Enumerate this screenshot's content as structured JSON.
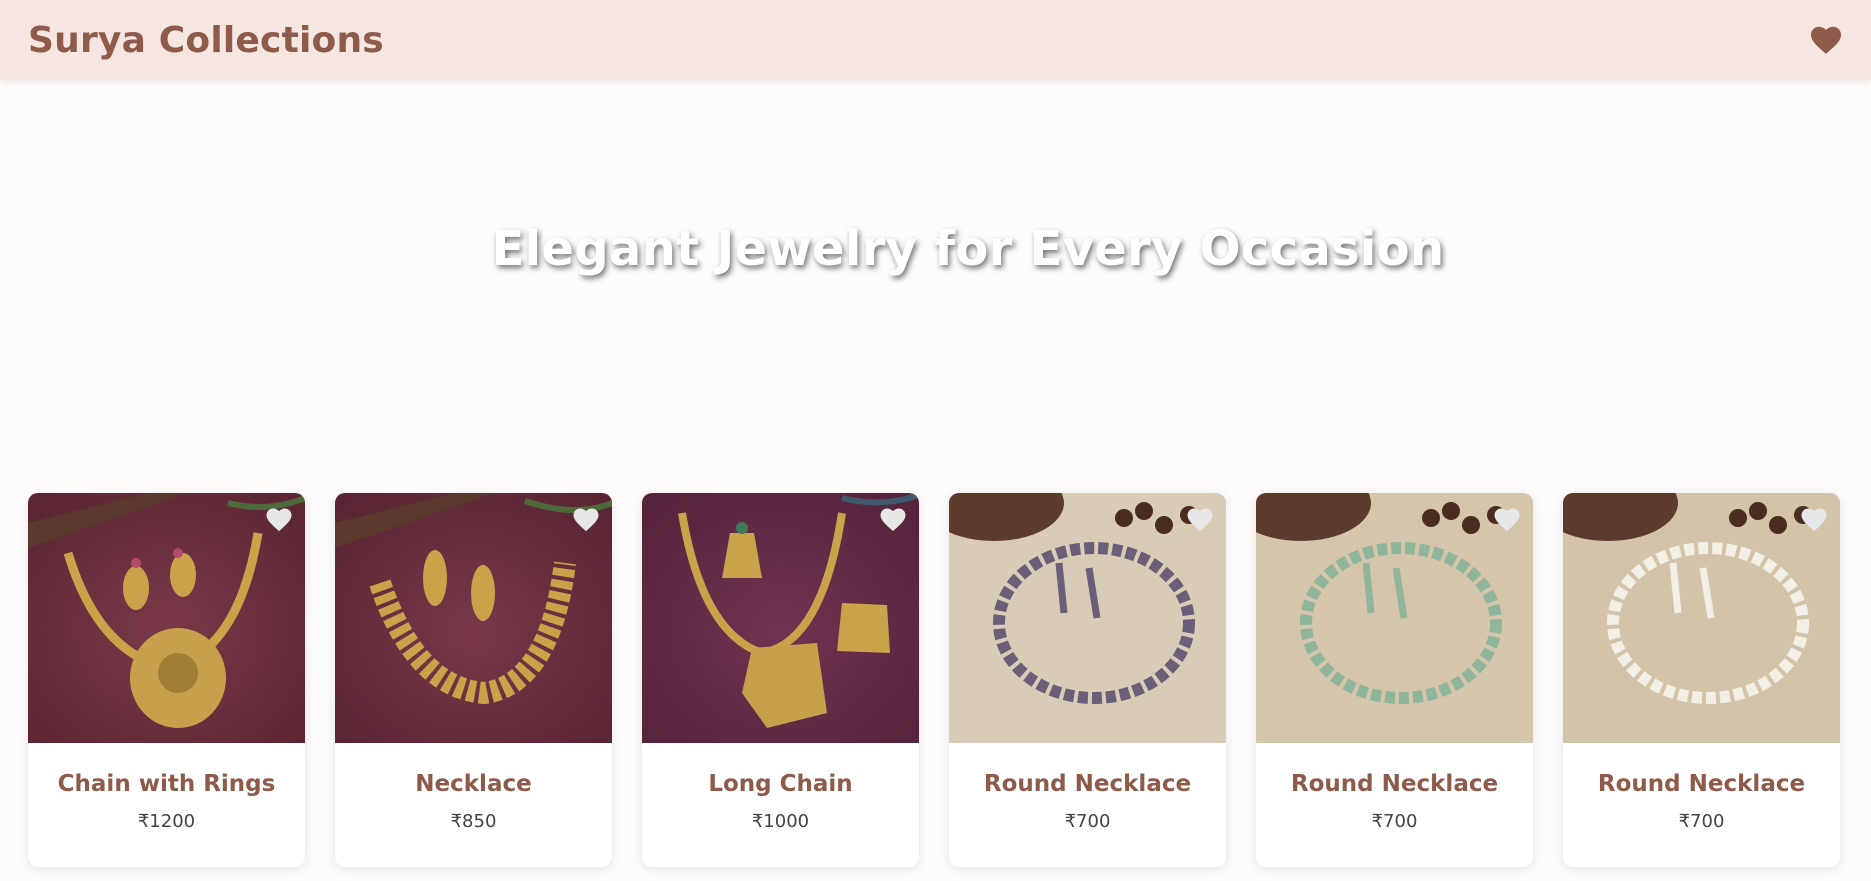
{
  "header": {
    "brand": "Surya Collections",
    "wishlist_icon": "heart-icon",
    "brand_color": "#8e5a49",
    "background": "#f5e6e1"
  },
  "hero": {
    "title": "Elegant Jewelry for Every Occasion"
  },
  "products": [
    {
      "name": "Chain with Rings",
      "price": "₹1200",
      "image": "gold-temple-necklace-with-earrings-on-maroon",
      "favorite_icon": "heart-icon"
    },
    {
      "name": "Necklace",
      "price": "₹850",
      "image": "gold-peacock-necklace-with-jhumka-earrings-on-maroon",
      "favorite_icon": "heart-icon"
    },
    {
      "name": "Long Chain",
      "price": "₹1000",
      "image": "gold-long-chain-with-pendant-on-maroon",
      "favorite_icon": "heart-icon"
    },
    {
      "name": "Round Necklace",
      "price": "₹700",
      "image": "purple-stone-round-necklace-on-beige",
      "favorite_icon": "heart-icon"
    },
    {
      "name": "Round Necklace",
      "price": "₹700",
      "image": "mint-stone-round-necklace-on-beige",
      "favorite_icon": "heart-icon"
    },
    {
      "name": "Round Necklace",
      "price": "₹700",
      "image": "white-stone-round-necklace-on-beige",
      "favorite_icon": "heart-icon"
    }
  ]
}
